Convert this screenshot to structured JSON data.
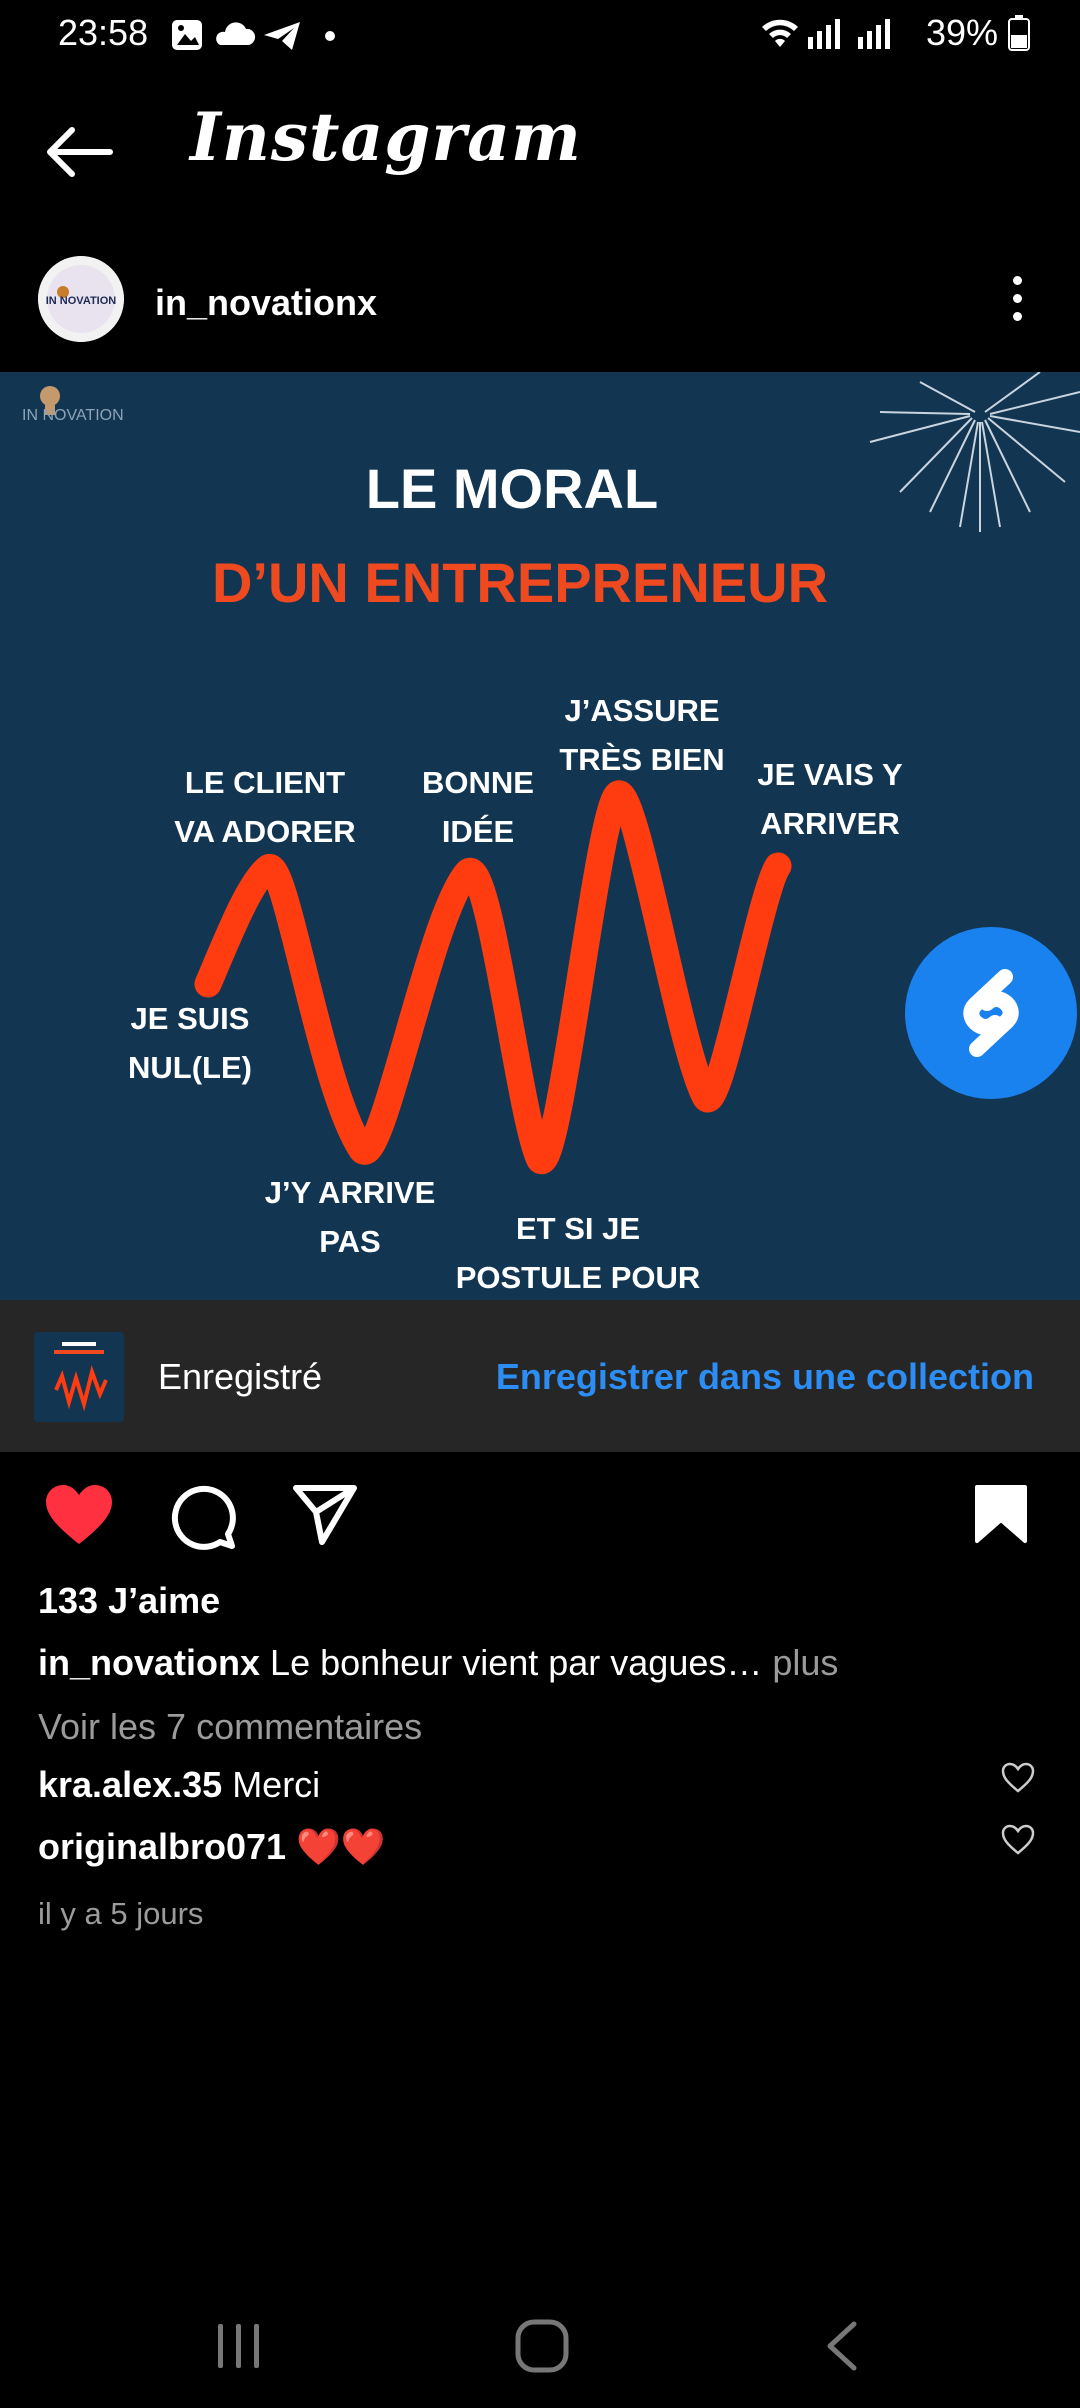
{
  "status": {
    "time": "23:58",
    "battery": "39%"
  },
  "app": {
    "title": "Instagram"
  },
  "post": {
    "username": "in_novationx",
    "avatar_text": "IN NOVATION",
    "watermark": "IN NOVATION",
    "image": {
      "title_line1": "LE MORAL",
      "title_line2": "D’UN ENTREPRENEUR",
      "labels": {
        "le_client_1": "LE CLIENT",
        "le_client_2": "VA ADORER",
        "bonne_1": "BONNE",
        "bonne_2": "IDÉE",
        "jassure_1": "J’ASSURE",
        "jassure_2": "TRÈS BIEN",
        "jevais_1": "JE VAIS Y",
        "jevais_2": "ARRIVER",
        "jesuis_1": "JE SUIS",
        "jesuis_2": "NUL(LE)",
        "jyarrive_1": "J’Y ARRIVE",
        "jyarrive_2": "PAS",
        "etsi_1": "ET SI JE",
        "etsi_2": "POSTULE POUR"
      }
    },
    "saved_label": "Enregistré",
    "save_collection_label": "Enregistrer dans une collection",
    "likes": "133 J’aime",
    "caption_user": "in_novationx",
    "caption_text": "Le bonheur vient par vagues…",
    "caption_more": "plus",
    "view_comments": "Voir les 7 commentaires",
    "comments": [
      {
        "user": "kra.alex.35",
        "text": "Merci"
      },
      {
        "user": "originalbro071",
        "text": "❤️❤️"
      }
    ],
    "time_ago": "il y a 5 jours"
  },
  "colors": {
    "accent": "#ef4a1f",
    "link": "#2c8ef5",
    "poster_bg": "#123652",
    "like": "#ff3040"
  }
}
